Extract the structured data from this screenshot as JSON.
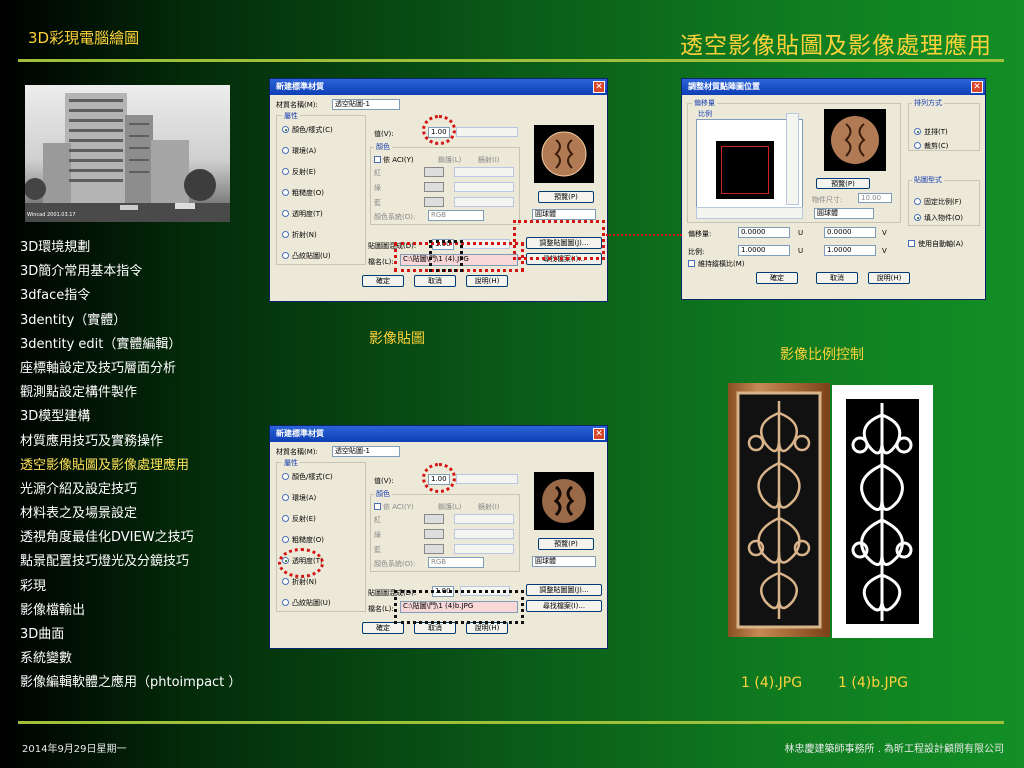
{
  "header": {
    "left_title": "3D彩現電腦繪圖",
    "right_title": "透空影像貼圖及影像處理應用"
  },
  "nav": {
    "items": [
      "3D環境規劃",
      "3D簡介常用基本指令",
      "3dface指令",
      "3dentity（實體）",
      "3dentity edit（實體編輯）",
      "座標軸設定及技巧層面分析",
      "觀測點設定構件製作",
      "3D模型建構",
      "材質應用技巧及實務操作",
      "透空影像貼圖及影像處理應用",
      "光源介紹及設定技巧",
      "材料表之及場景設定",
      "透視角度最佳化DVIEW之技巧",
      "點景配置技巧燈光及分鏡技巧",
      "彩現",
      "影像檔輸出",
      "3D曲面",
      "系統變數",
      "影像編輯軟體之應用（phtoimpact ）"
    ],
    "active_index": 9
  },
  "captions": {
    "image_mapping": "影像貼圖",
    "image_scale": "影像比例控制",
    "file1": "1 (4).JPG",
    "file2": "1 (4)b.JPG"
  },
  "footer": {
    "date": "2014年9月29日星期一",
    "company": "林忠慶建築師事務所 . 為昕工程設計顧問有限公司"
  },
  "photo": {
    "watermark": "Wincad 2001.03.17"
  },
  "dialog_material": {
    "title": "新建標準材質",
    "close": "✕",
    "name_label": "材質名稱(M):",
    "name_value": "透空貼圖-1",
    "attributes_label": "屬性",
    "attributes": [
      "顏色/樣式(C)",
      "環境(A)",
      "反射(E)",
      "粗糙度(O)",
      "透明度(T)",
      "折射(N)",
      "凸紋貼圖(U)"
    ],
    "value_label": "值(V):",
    "value": "1.00",
    "color_label": "顏色",
    "by_aci": "依 ACI(Y)",
    "lock": "鎖護(L)",
    "mirror": "鏡射(I)",
    "rgb_red": "紅",
    "rgb_green": "綠",
    "rgb_blue": "藍",
    "color_system_label": "顏色系統(O):",
    "color_system_value": "RGB",
    "preview_button": "預覽(P)",
    "shape_value": "圓球體",
    "map_blend_label": "貼圖圖混成(D):",
    "map_blend_value": "1.00",
    "adjust_map_button": "調整貼圖圖(J)...",
    "file_label": "檔名(L):",
    "find_file_button": "尋找檔案(I)...",
    "ok": "確定",
    "cancel": "取消",
    "help": "說明(H)"
  },
  "dialog1": {
    "file_value": "C:\\貼圖\\門\\1 (4).JPG",
    "selected_index": 0
  },
  "dialog2": {
    "file_value": "C:\\貼圖\\門\\1 (4)b.JPG",
    "selected_index": 4
  },
  "dialog_adjust": {
    "title": "調整材質點陣圖位置",
    "close": "✕",
    "offset_label": "偏移量",
    "scale_label": "比例",
    "tiling_label": "排列方式",
    "tile": "並排(T)",
    "crop": "裁剪(C)",
    "preview_button": "預覽(P)",
    "object_size_label": "物件尺寸:",
    "object_size_value": "10.00",
    "shape_value": "圓球體",
    "map_type_label": "貼圖型式",
    "fixed_scale": "固定比例(F)",
    "fit_object": "填入物件(O)",
    "offset_row_label": "偏移量:",
    "offset_u": "0.0000",
    "offset_v": "0.0000",
    "scale_row_label": "比例:",
    "scale_u": "1.0000",
    "scale_v": "1.0000",
    "u": "U",
    "v": "V",
    "auto_axis": "使用自動軸(A)",
    "keep_aspect": "維持縱橫比(M)",
    "ok": "確定",
    "cancel": "取消",
    "help": "說明(H)"
  }
}
